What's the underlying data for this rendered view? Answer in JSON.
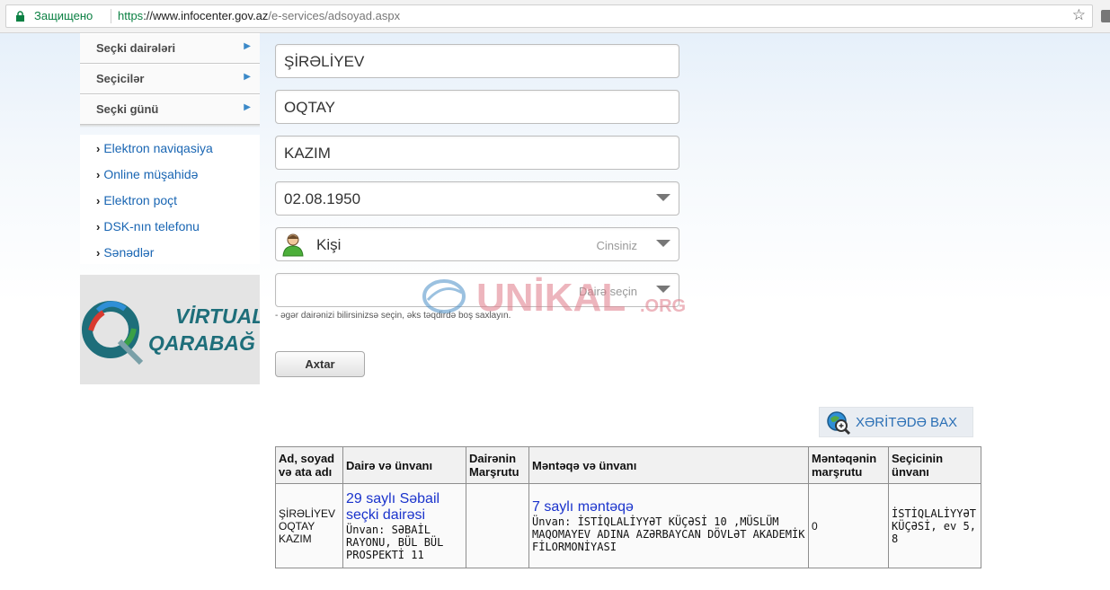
{
  "browser": {
    "secure_label": "Защищено",
    "url_scheme": "https",
    "url_host": "://www.infocenter.gov.az",
    "url_path": "/e-services/adsoyad.aspx"
  },
  "leftmenu": {
    "items": [
      {
        "label": "Seçki dairələri"
      },
      {
        "label": "Seçicilər"
      },
      {
        "label": "Seçki günü"
      }
    ],
    "links": [
      {
        "label": "Elektron naviqasiya"
      },
      {
        "label": "Online müşahidə"
      },
      {
        "label": "Elektron poçt"
      },
      {
        "label": "DSK-nın telefonu"
      },
      {
        "label": "Sənədlər"
      }
    ],
    "banner": {
      "line1": "VİRTUAL",
      "line2": "QARABAĞ"
    }
  },
  "form": {
    "surname": "ŞİRƏLİYEV",
    "name": "OQTAY",
    "patronymic": "KAZIM",
    "birthdate": "02.08.1950",
    "gender": "Kişi",
    "gender_hint": "Cinsiniz",
    "district_hint": "Dairə seçin",
    "district_note": "- əgər dairənizi bilirsinizsə seçin, əks təqdirdə boş saxlayın.",
    "search_button": "Axtar"
  },
  "watermark": {
    "text": "UNİKAL",
    "suffix": ".ORG"
  },
  "map_button": {
    "label": "XƏRİTƏDƏ BAX"
  },
  "results": {
    "headers": [
      "Ad, soyad və ata adı",
      "Dairə və ünvanı",
      "Dairənin Marşrutu",
      "Məntəqə və ünvanı",
      "Məntəqənin marşrutu",
      "Seçicinin ünvanı"
    ],
    "row": {
      "full_name": "ŞİRƏLİYEV OQTAY KAZIM",
      "district_link": "29 saylı Səbail seçki dairəsi",
      "district_address": "Ünvan: SƏBAİL RAYONU, BÜL BÜL PROSPEKTİ 11",
      "district_route": "",
      "station_link": "7 saylı məntəqə",
      "station_address": "Ünvan: İSTİQLALİYYƏT KÜÇƏSİ 10 ,MÜSLÜM MAQOMAYEV ADINA AZƏRBAYCAN DÖVLƏT AKADEMİK FİLORMONİYASI",
      "station_route": "0",
      "voter_address": "İSTİQLALİYYƏT KÜÇƏSİ, ev 5, 8"
    }
  }
}
